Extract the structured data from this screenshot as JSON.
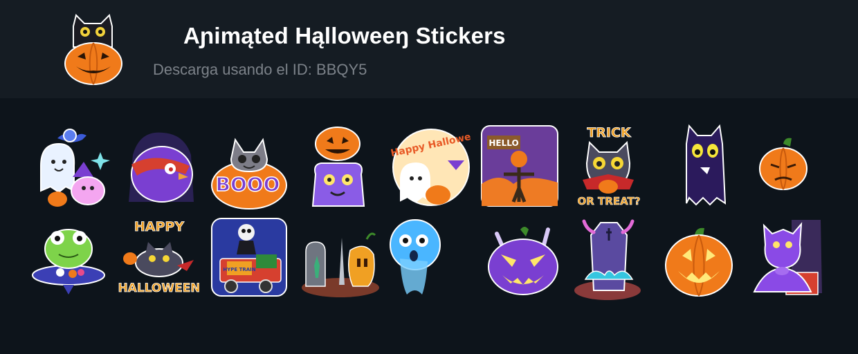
{
  "pack": {
    "title": "Aɲimąted Hąlloweeŋ Stickers",
    "download_text": "Descarga usando el ID: BBQY5"
  },
  "logo": {
    "icon": "cat-in-pumpkin-icon"
  },
  "stickers": [
    {
      "name": "ghost-bat-cat-sticker"
    },
    {
      "name": "purple-vampire-bird-sticker"
    },
    {
      "name": "cat-in-pumpkin-booo-sticker",
      "text": "BOOO"
    },
    {
      "name": "purple-monster-pumpkin-head-sticker"
    },
    {
      "name": "happy-halloween-ghost-sticker",
      "text": "Happy Halloween"
    },
    {
      "name": "scarecrow-hello-sticker",
      "text": "HELLO"
    },
    {
      "name": "trick-or-treat-cat-sticker",
      "text_top": "TRICK",
      "text_bottom": "OR TREAT?"
    },
    {
      "name": "purple-cat-ghost-sticker"
    },
    {
      "name": "grumpy-pumpkin-sticker"
    },
    {
      "name": "frog-witch-hat-sticker"
    },
    {
      "name": "happy-halloween-flying-cat-sticker",
      "text_top": "HAPPY",
      "text_bottom": "HALLOWEEN"
    },
    {
      "name": "hype-train-skeleton-sticker",
      "text": "HYPE TRAIN"
    },
    {
      "name": "grave-knife-pumpkin-sticker"
    },
    {
      "name": "blue-ghost-sticker"
    },
    {
      "name": "evil-purple-pumpkin-sticker"
    },
    {
      "name": "coffin-demon-hands-sticker"
    },
    {
      "name": "jack-o-lantern-sticker"
    },
    {
      "name": "purple-vampire-sticker"
    }
  ],
  "colors": {
    "background": "#0d141b",
    "header": "#151c23",
    "title": "#ffffff",
    "subtitle": "#7c8289",
    "pumpkin": "#f07a1a",
    "purple": "#7a3fd1"
  }
}
